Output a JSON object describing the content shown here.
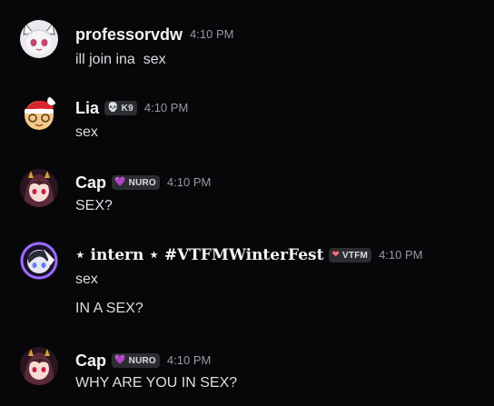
{
  "messages": [
    {
      "username": "professorvdw",
      "timestamp": "4:10 PM",
      "avatar": "white-cat-girl-avatar",
      "lines": [
        "ill join ina  sex"
      ]
    },
    {
      "username": "Lia",
      "timestamp": "4:10 PM",
      "avatar": "santa-hat-avatar",
      "tag": {
        "label": "K9",
        "icon": "skull-icon",
        "color": "#b5bac1"
      },
      "lines": [
        "sex"
      ]
    },
    {
      "username": "Cap",
      "timestamp": "4:10 PM",
      "avatar": "anime-girl-avatar",
      "tag": {
        "label": "NURO",
        "icon": "heart-icon",
        "color": "#b49cff"
      },
      "lines": [
        "SEX?"
      ]
    },
    {
      "username": "⋆ 𝐢𝐧𝐭𝐞𝐫𝐧 ⋆ #VTFMWinterFest",
      "timestamp": "4:10 PM",
      "avatar": "purple-glow-avatar",
      "tag": {
        "label": "VTFM",
        "icon": "heart-icon",
        "color": "#ff6b7a"
      },
      "lines": [
        "sex",
        "IN A SEX?"
      ]
    },
    {
      "username": "Cap",
      "timestamp": "4:10 PM",
      "avatar": "anime-girl-avatar",
      "tag": {
        "label": "NURO",
        "icon": "heart-icon",
        "color": "#b49cff"
      },
      "lines": [
        "WHY ARE YOU IN SEX?"
      ]
    }
  ]
}
